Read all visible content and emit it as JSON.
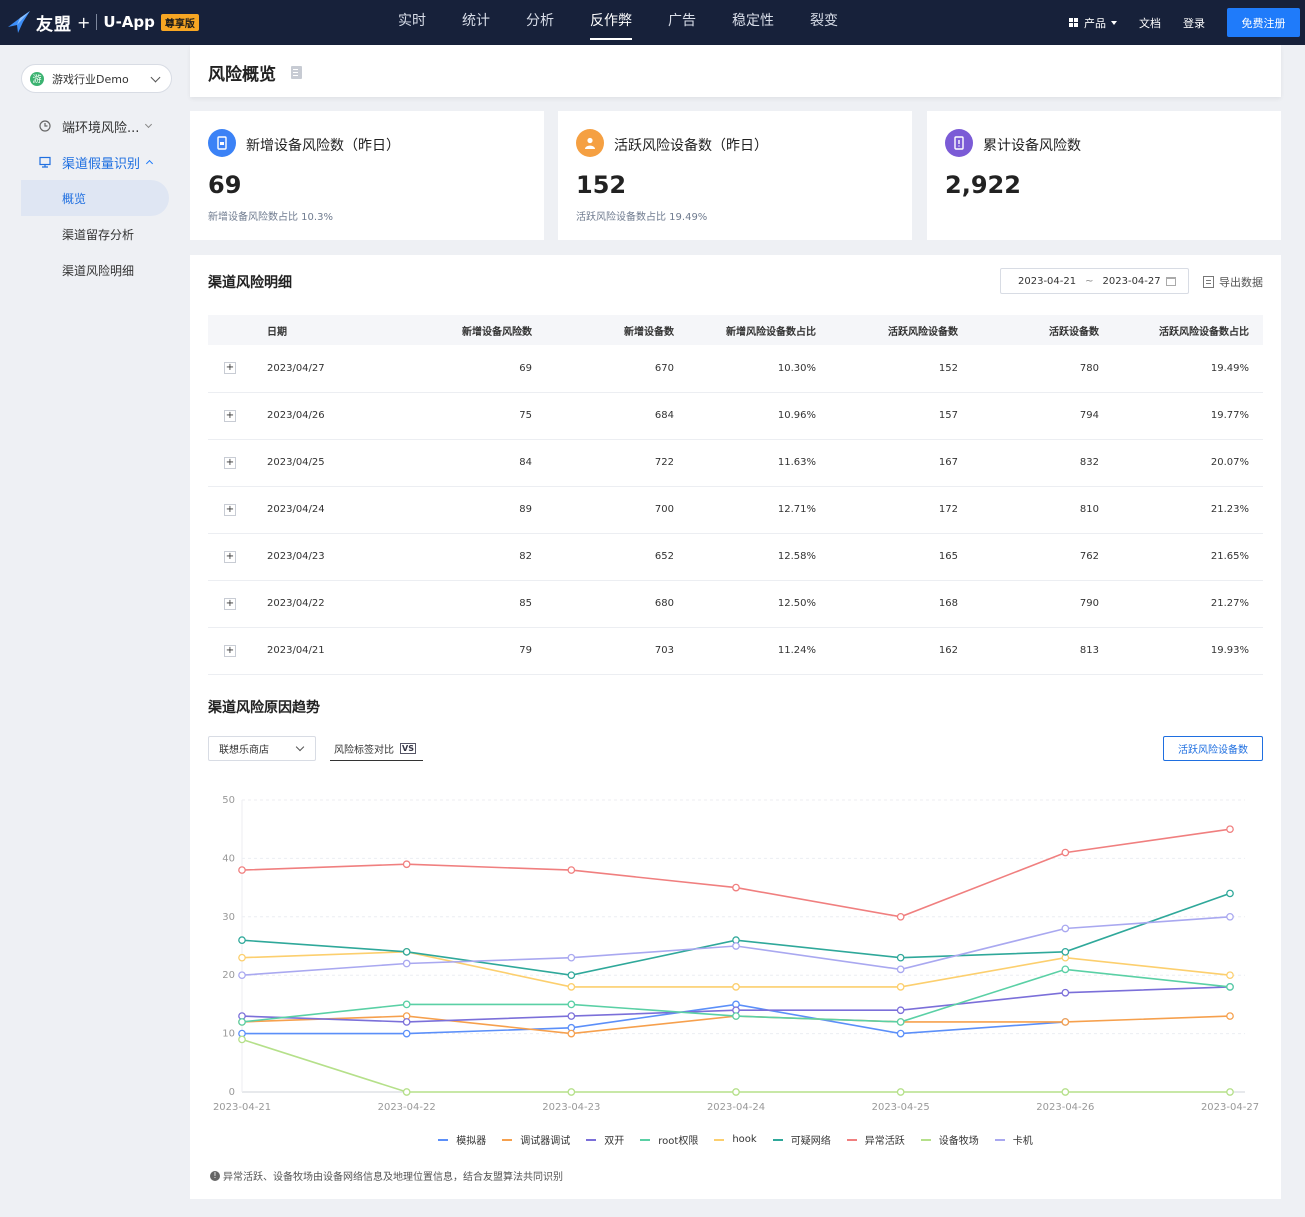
{
  "brand": {
    "cn": "友盟",
    "plus": "+",
    "product": "U-App",
    "badge": "尊享版"
  },
  "nav": [
    "实时",
    "统计",
    "分析",
    "反作弊",
    "广告",
    "稳定性",
    "裂变"
  ],
  "nav_active": "反作弊",
  "top_right": {
    "product": "产品",
    "docs": "文档",
    "login": "登录",
    "signup": "免费注册"
  },
  "sidebar": {
    "app_icon": "游",
    "app_name": "游戏行业Demo",
    "groups": [
      {
        "label": "端环境风险...",
        "icon": "clock-shield-icon"
      },
      {
        "label": "渠道假量识别",
        "icon": "channel-icon"
      }
    ],
    "items": [
      "概览",
      "渠道留存分析",
      "渠道风险明细"
    ]
  },
  "page_title": "风险概览",
  "metrics": [
    {
      "label": "新增设备风险数（昨日）",
      "value": "69",
      "sub": "新增设备风险数占比 10.3%",
      "color": "#3b82f6"
    },
    {
      "label": "活跃风险设备数（昨日）",
      "value": "152",
      "sub": "活跃风险设备数占比 19.49%",
      "color": "#f5a042"
    },
    {
      "label": "累计设备风险数",
      "value": "2,922",
      "sub": "",
      "color": "#7b5bd6"
    }
  ],
  "detail": {
    "title": "渠道风险明细",
    "date_start": "2023-04-21",
    "date_sep": "~",
    "date_end": "2023-04-27",
    "export": "导出数据",
    "expand": "+",
    "columns": [
      "日期",
      "新增设备风险数",
      "新增设备数",
      "新增风险设备数占比",
      "活跃风险设备数",
      "活跃设备数",
      "活跃风险设备数占比"
    ],
    "rows": [
      [
        "2023/04/27",
        "69",
        "670",
        "10.30%",
        "152",
        "780",
        "19.49%"
      ],
      [
        "2023/04/26",
        "75",
        "684",
        "10.96%",
        "157",
        "794",
        "19.77%"
      ],
      [
        "2023/04/25",
        "84",
        "722",
        "11.63%",
        "167",
        "832",
        "20.07%"
      ],
      [
        "2023/04/24",
        "89",
        "700",
        "12.71%",
        "172",
        "810",
        "21.23%"
      ],
      [
        "2023/04/23",
        "82",
        "652",
        "12.58%",
        "165",
        "762",
        "21.65%"
      ],
      [
        "2023/04/22",
        "85",
        "680",
        "12.50%",
        "168",
        "790",
        "21.27%"
      ],
      [
        "2023/04/21",
        "79",
        "703",
        "11.24%",
        "162",
        "813",
        "19.93%"
      ]
    ]
  },
  "trend": {
    "title": "渠道风险原因趋势",
    "store": "联想乐商店",
    "compare": "风险标签对比",
    "vs": "VS",
    "metric_button": "活跃风险设备数",
    "footnote": "异常活跃、设备牧场由设备网络信息及地理位置信息，结合友盟算法共同识别",
    "info": "!"
  },
  "chart_data": {
    "type": "line",
    "x": [
      "2023-04-21",
      "2023-04-22",
      "2023-04-23",
      "2023-04-24",
      "2023-04-25",
      "2023-04-26",
      "2023-04-27"
    ],
    "ylim": [
      0,
      50
    ],
    "yticks": [
      0,
      10,
      20,
      30,
      40,
      50
    ],
    "grid": true,
    "legend": "bottom",
    "series": [
      {
        "name": "模拟器",
        "color": "#5b8ff9",
        "values": [
          10,
          10,
          11,
          15,
          10,
          12,
          null
        ]
      },
      {
        "name": "调试器调试",
        "color": "#f6a04d",
        "values": [
          12,
          13,
          10,
          13,
          12,
          12,
          13
        ]
      },
      {
        "name": "双开",
        "color": "#7b6fd9",
        "values": [
          13,
          12,
          13,
          14,
          14,
          17,
          18
        ]
      },
      {
        "name": "root权限",
        "color": "#5ad0a5",
        "values": [
          12,
          15,
          15,
          13,
          12,
          21,
          18
        ]
      },
      {
        "name": "hook",
        "color": "#fccf6e",
        "values": [
          23,
          24,
          18,
          18,
          18,
          23,
          20
        ]
      },
      {
        "name": "可疑网络",
        "color": "#2fa89a",
        "values": [
          26,
          24,
          20,
          26,
          23,
          24,
          34
        ]
      },
      {
        "name": "异常活跃",
        "color": "#f07f7f",
        "values": [
          38,
          39,
          38,
          35,
          30,
          41,
          45
        ]
      },
      {
        "name": "设备牧场",
        "color": "#b5e08a",
        "values": [
          9,
          0,
          0,
          0,
          0,
          0,
          0
        ]
      },
      {
        "name": "卡机",
        "color": "#a9a8f0",
        "values": [
          20,
          22,
          23,
          25,
          21,
          28,
          30
        ]
      }
    ]
  }
}
